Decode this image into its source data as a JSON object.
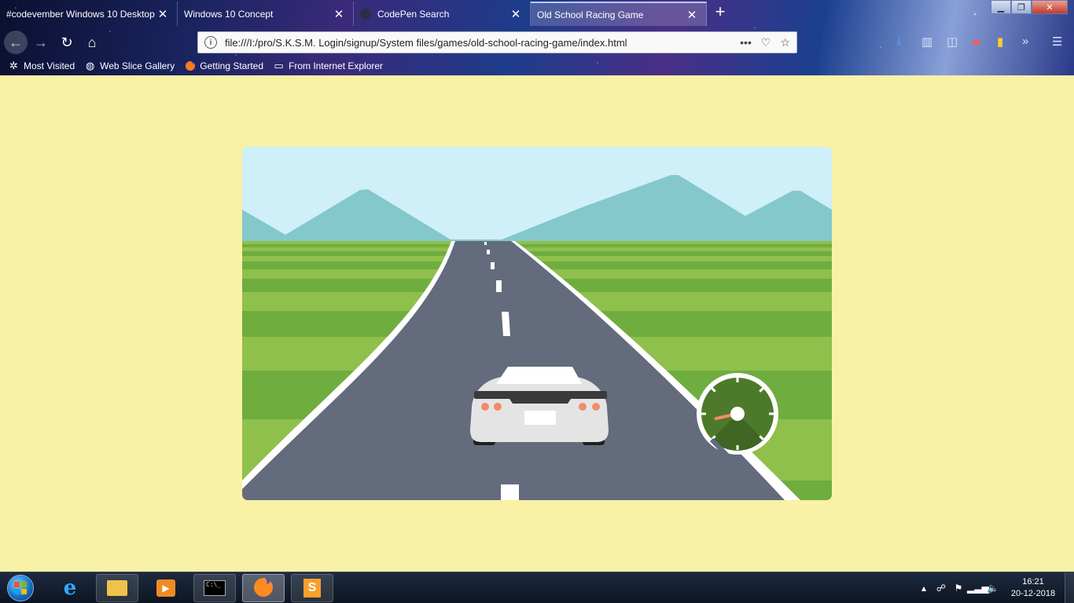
{
  "browser": {
    "tabs": [
      {
        "title": "#codevember Windows 10 Desktop",
        "active": false
      },
      {
        "title": "Windows 10 Concept",
        "active": false
      },
      {
        "title": "CodePen Search",
        "active": false
      },
      {
        "title": "Old School Racing Game",
        "active": true
      }
    ],
    "new_tab_label": "+",
    "url": "file:///I:/pro/S.K.S.M. Login/signup/System files/games/old-school-racing-game/index.html",
    "bookmarks": [
      {
        "label": "Most Visited",
        "icon": "gear-icon"
      },
      {
        "label": "Web Slice Gallery",
        "icon": "globe-icon"
      },
      {
        "label": "Getting Started",
        "icon": "firefox-icon"
      },
      {
        "label": "From Internet Explorer",
        "icon": "folder-icon"
      }
    ]
  },
  "game": {
    "colors": {
      "sky": "#cfeff9",
      "mountains": "#84c8cb",
      "grass_light": "#8fc04c",
      "grass_dark": "#6fad3f",
      "road": "#636b7c",
      "road_edge": "#ffffff",
      "car_body": "#e4e4e4",
      "tail_light": "#f28b6c",
      "speedometer": "#4d7a2a"
    },
    "speedometer_needle_fraction": 0.12
  },
  "taskbar": {
    "apps": [
      {
        "name": "internet-explorer-icon"
      },
      {
        "name": "file-explorer-icon"
      },
      {
        "name": "media-player-icon"
      },
      {
        "name": "command-prompt-icon"
      },
      {
        "name": "firefox-icon",
        "active": true
      },
      {
        "name": "sublime-text-icon"
      }
    ],
    "time": "16:21",
    "date": "20-12-2018"
  }
}
